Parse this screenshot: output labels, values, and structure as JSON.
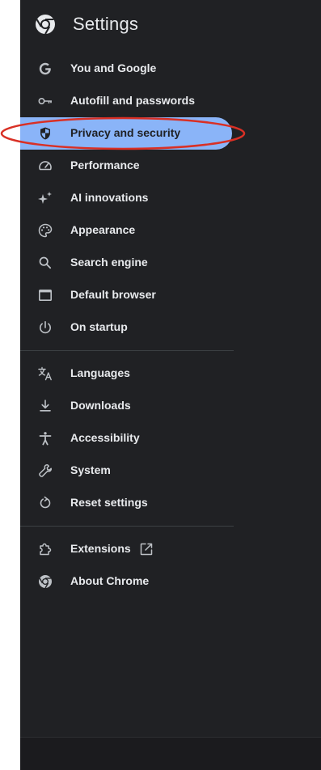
{
  "header": {
    "title": "Settings",
    "logo_icon": "chrome-logo-icon"
  },
  "nav": {
    "items": [
      {
        "label": "You and Google",
        "icon": "google-g-icon"
      },
      {
        "label": "Autofill and passwords",
        "icon": "key-icon"
      },
      {
        "label": "Privacy and security",
        "icon": "shield-icon",
        "selected": true
      },
      {
        "label": "Performance",
        "icon": "speedometer-icon"
      },
      {
        "label": "AI innovations",
        "icon": "sparkle-icon"
      },
      {
        "label": "Appearance",
        "icon": "palette-icon"
      },
      {
        "label": "Search engine",
        "icon": "search-icon"
      },
      {
        "label": "Default browser",
        "icon": "browser-window-icon"
      },
      {
        "label": "On startup",
        "icon": "power-icon"
      },
      {
        "label": "Languages",
        "icon": "translate-icon"
      },
      {
        "label": "Downloads",
        "icon": "download-icon"
      },
      {
        "label": "Accessibility",
        "icon": "accessibility-icon"
      },
      {
        "label": "System",
        "icon": "wrench-icon"
      },
      {
        "label": "Reset settings",
        "icon": "reset-icon"
      },
      {
        "label": "Extensions",
        "icon": "puzzle-icon",
        "external_link_icon": "open-in-new-icon"
      },
      {
        "label": "About Chrome",
        "icon": "chrome-logo-icon"
      }
    ]
  },
  "colors": {
    "panel_background": "#202124",
    "selected_background": "#8ab4f8",
    "text": "#e8eaed",
    "icon": "#bdc1c6",
    "annotation_ring": "#d93025"
  }
}
